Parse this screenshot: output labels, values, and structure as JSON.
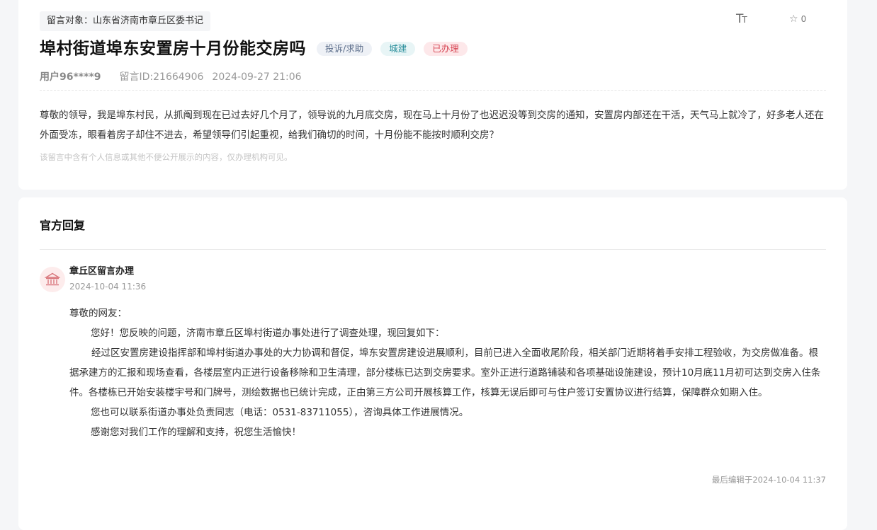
{
  "message": {
    "target_label": "留言对象：",
    "target": "山东省济南市章丘区委书记",
    "font_toggle_big": "T",
    "font_toggle_small": "T",
    "favorite_count": "0",
    "title": "埠村街道埠东安置房十月份能交房吗",
    "badges": {
      "type": "投诉/求助",
      "category": "城建",
      "status": "已办理"
    },
    "user": "用户96****9",
    "message_id": "留言ID:21664906",
    "datetime": "2024-09-27 21:06",
    "content": "尊敬的领导，我是埠东村民，从抓阄到现在已过去好几个月了，领导说的九月底交房，现在马上十月份了也迟迟没等到交房的通知，安置房内部还在干活，天气马上就冷了，好多老人还在外面受冻，眼看着房子却住不进去，希望领导们引起重视，给我们确切的时间，十月份能不能按时顺利交房？",
    "privacy_note": "该留言中含有个人信息或其他不便公开展示的内容，仅办理机构可见。"
  },
  "reply": {
    "heading": "官方回复",
    "org_name": "章丘区留言办理",
    "org_time": "2024-10-04 11:36",
    "greeting": "尊敬的网友：",
    "p1": "您好！您反映的问题，济南市章丘区埠村街道办事处进行了调查处理，现回复如下：",
    "p2": "经过区安置房建设指挥部和埠村街道办事处的大力协调和督促，埠东安置房建设进展顺利，目前已进入全面收尾阶段，相关部门近期将着手安排工程验收，为交房做准备。根据承建方的汇报和现场查看，各楼层室内正进行设备移除和卫生清理，部分楼栋已达到交房要求。室外正进行道路铺装和各项基础设施建设，预计10月底11月初可达到交房入住条件。各楼栋已开始安装楼宇号和门牌号，测绘数据也已统计完成，正由第三方公司开展核算工作，核算无误后即可与住户签订安置协议进行结算，保障群众如期入住。",
    "p3": "您也可以联系街道办事处负责同志（电话：0531-83711055），咨询具体工作进展情况。",
    "p4": "感谢您对我们工作的理解和支持，祝您生活愉快！",
    "edited": "最后编辑于2024-10-04 11:37"
  },
  "colors": {
    "status_red": "#d64553",
    "category_teal": "#2a8e9b",
    "type_slate": "#5b6d8a"
  },
  "icons": {
    "font_size": "font-size-icon",
    "favorite": "star-icon",
    "org": "government-building-icon"
  }
}
